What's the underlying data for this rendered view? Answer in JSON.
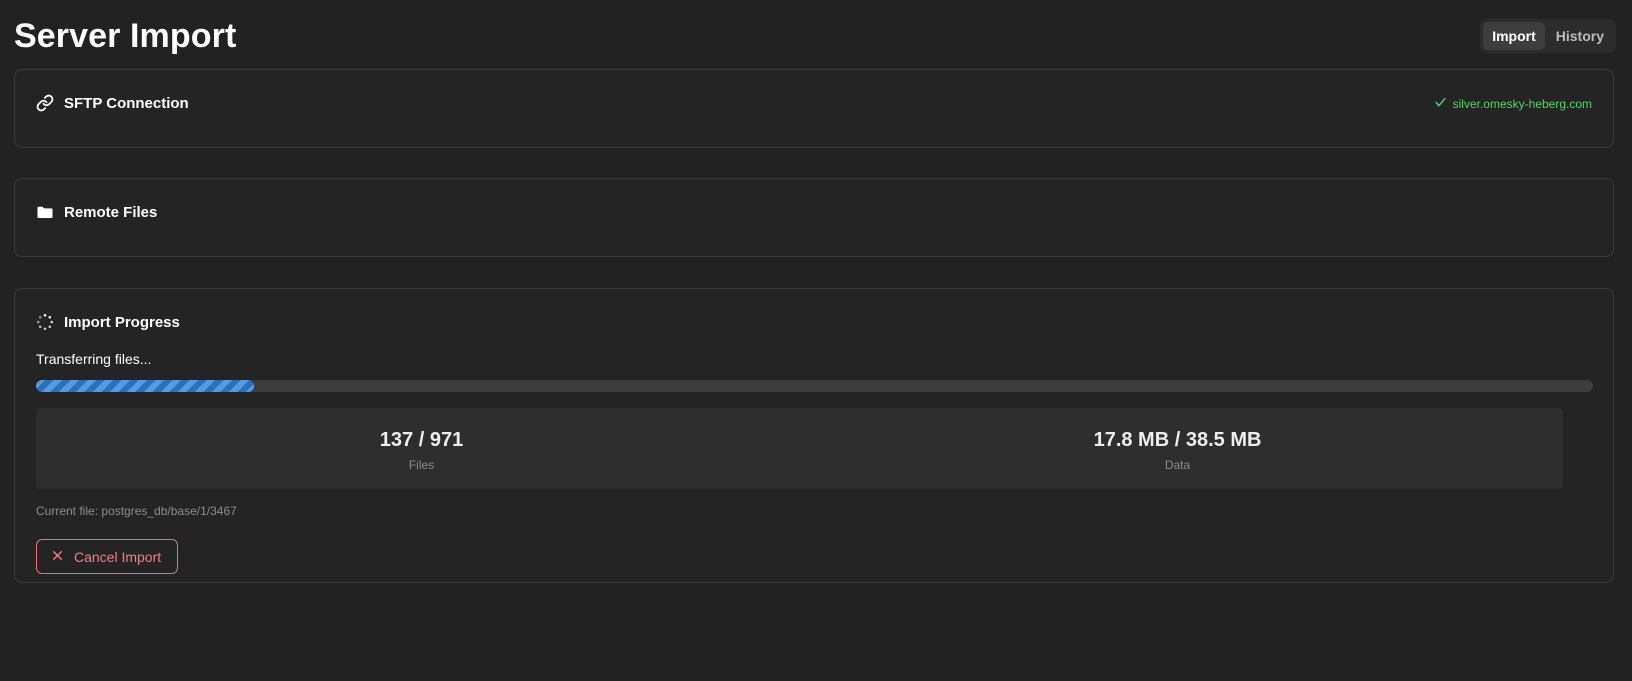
{
  "page": {
    "title": "Server Import"
  },
  "view_tabs": [
    {
      "label": "Import",
      "active": true
    },
    {
      "label": "History",
      "active": false
    }
  ],
  "sftp": {
    "title": "SFTP Connection",
    "icon": "link-icon",
    "status_icon": "check-icon",
    "host": "silver.omesky-heberg.com",
    "status_color": "#4cd964"
  },
  "remote_files": {
    "title": "Remote Files",
    "icon": "folder-icon"
  },
  "import_progress": {
    "title": "Import Progress",
    "icon": "spinner-icon",
    "status_text": "Transferring files...",
    "progress_percent": 14,
    "progress_color": "#3a86d8",
    "stats": [
      {
        "value": "137 / 971",
        "label": "Files"
      },
      {
        "value": "17.8 MB / 38.5 MB",
        "label": "Data"
      }
    ],
    "current_file": "Current file: postgres_db/base/1/3467",
    "cancel_label": "Cancel Import",
    "cancel_color": "#ff7b7b"
  }
}
